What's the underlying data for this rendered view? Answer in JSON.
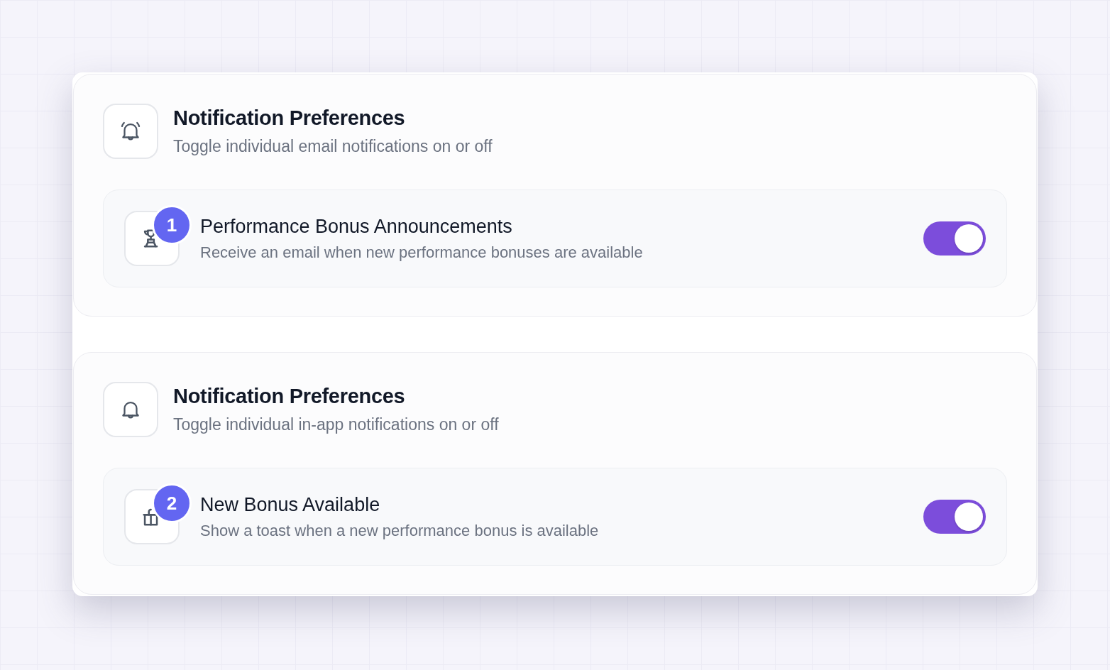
{
  "sections": [
    {
      "title": "Notification Preferences",
      "subtitle": "Toggle individual email notifications on or off",
      "items": [
        {
          "badge": "1",
          "title": "Performance Bonus Announcements",
          "description": "Receive an email when new performance bonuses are available",
          "on": true
        }
      ]
    },
    {
      "title": "Notification Preferences",
      "subtitle": "Toggle individual in-app notifications on or off",
      "items": [
        {
          "badge": "2",
          "title": "New Bonus Available",
          "description": "Show a toast when a new performance bonus is available",
          "on": true
        }
      ]
    }
  ]
}
